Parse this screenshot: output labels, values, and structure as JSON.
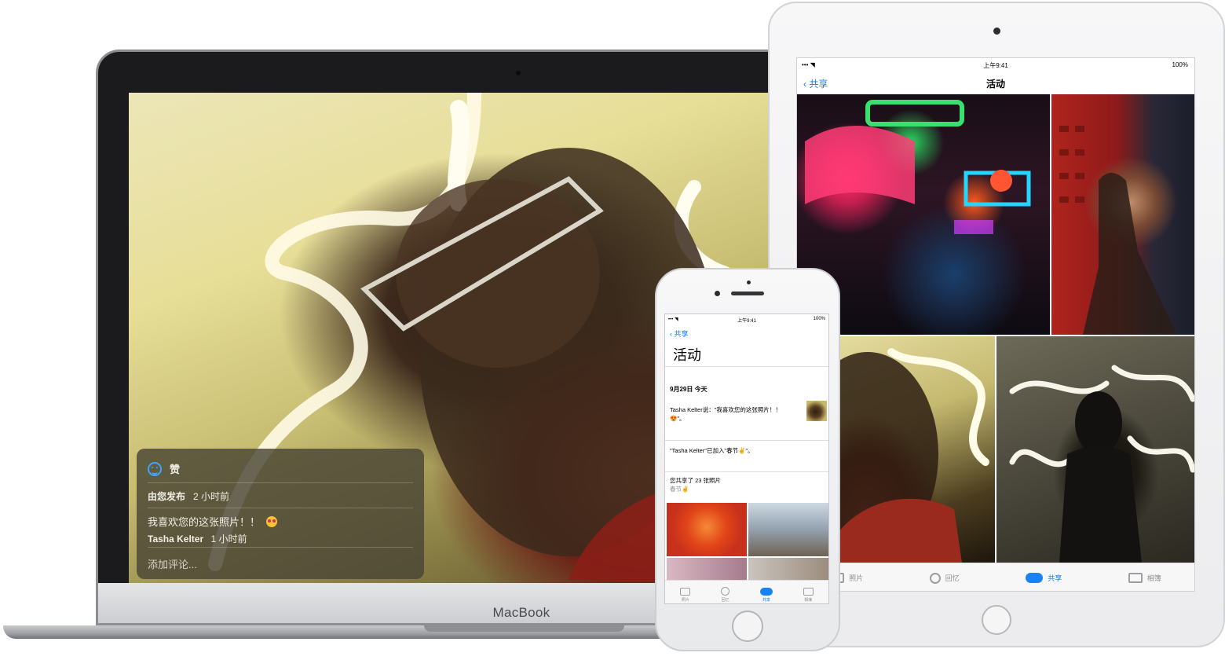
{
  "macbook": {
    "brand": "MacBook",
    "comment_panel": {
      "like_label": "赞",
      "posted_by": "由您发布",
      "posted_time": "2 小时前",
      "comment_text": "我喜欢您的这张照片！！",
      "comment_author": "Tasha Kelter",
      "comment_time": "1 小时前",
      "add_comment_placeholder": "添加评论..."
    }
  },
  "ipad": {
    "status": {
      "time": "上午9:41",
      "battery": "100%",
      "signal": "••• ◥"
    },
    "nav": {
      "back_label": "共享",
      "title": "活动"
    },
    "tabs": [
      {
        "label": "照片",
        "icon": "photos-icon"
      },
      {
        "label": "回忆",
        "icon": "memories-icon"
      },
      {
        "label": "共享",
        "icon": "cloud-icon",
        "active": true
      },
      {
        "label": "相簿",
        "icon": "albums-icon"
      }
    ]
  },
  "iphone": {
    "status": {
      "time": "上午9:41",
      "battery": "100%",
      "signal": "••• ◥"
    },
    "nav": {
      "back_label": "共享",
      "title": "活动"
    },
    "date_header": "9月29日 今天",
    "items": [
      {
        "text": "Tasha Kelter说：\"我喜欢您的这张照片！！",
        "emoji": "😍\"。"
      },
      {
        "text": "\"Tasha Kelter\"已加入\"春节✌\"。"
      },
      {
        "text": "您共享了 23 张照片",
        "sub": "春节✌"
      }
    ],
    "tabs": [
      {
        "label": "照片",
        "icon": "photos-icon"
      },
      {
        "label": "回忆",
        "icon": "memories-icon"
      },
      {
        "label": "共享",
        "icon": "cloud-icon",
        "active": true
      },
      {
        "label": "相簿",
        "icon": "albums-icon"
      }
    ]
  },
  "colors": {
    "accent": "#137cf0",
    "panel": "#494634"
  }
}
